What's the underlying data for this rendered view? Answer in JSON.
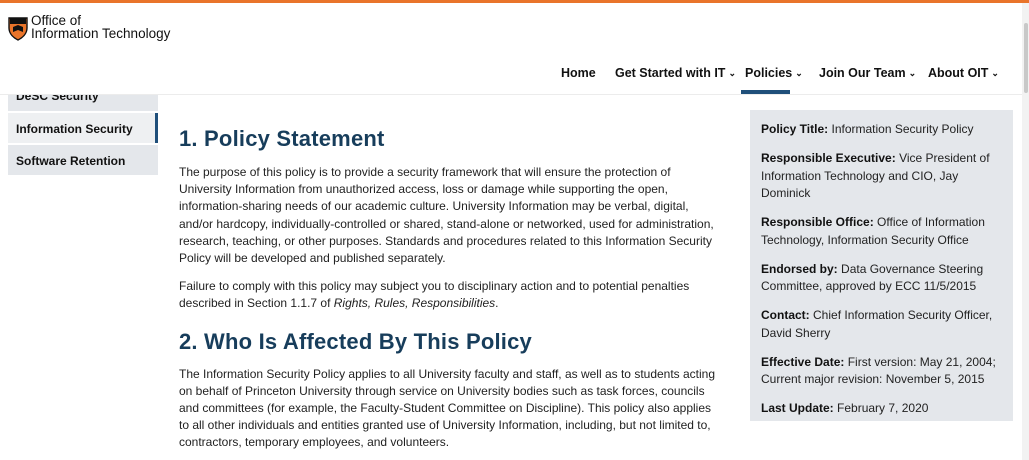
{
  "header": {
    "logo_line1": "Office of",
    "logo_line2": "Information Technology"
  },
  "nav": {
    "items": [
      {
        "label": "Home",
        "has_chevron": false
      },
      {
        "label": "Get Started with IT",
        "has_chevron": true
      },
      {
        "label": "Policies",
        "has_chevron": true,
        "active": true
      },
      {
        "label": "Join Our Team",
        "has_chevron": true
      },
      {
        "label": "About OIT",
        "has_chevron": true
      }
    ],
    "chevron": "⌄"
  },
  "sidebar": {
    "items": [
      {
        "label": "DeSC Security"
      },
      {
        "label": "Information Security",
        "active": true
      },
      {
        "label": "Software Retention"
      }
    ]
  },
  "main": {
    "section1_title": "1.  Policy Statement",
    "section1_p1": "The purpose of this policy is to provide a security framework that will ensure the protection of University Information from unauthorized access, loss or damage while supporting the open, information-sharing needs of our academic culture.  University Information may be verbal, digital, and/or hardcopy, individually-controlled or shared, stand-alone or networked, used for administration, research, teaching, or other purposes.  Standards and procedures related to this Information Security Policy will be developed and published separately.",
    "section1_p2_prefix": "Failure to comply with this policy may subject you to disciplinary action and to potential penalties described in Section 1.1.7 of ",
    "section1_p2_italic": "Rights, Rules, Responsibilities",
    "section1_p2_suffix": ".",
    "section2_title": "2.  Who Is Affected By This Policy",
    "section2_p1": "The Information Security Policy applies to all University faculty and staff, as well as to students acting on behalf of Princeton University through service on University bodies such as task forces, councils and committees (for example, the Faculty-Student Committee on Discipline).  This policy also applies to all other individuals and entities granted use of University Information, including, but not limited to, contractors, temporary employees, and volunteers."
  },
  "infobox": {
    "rows": [
      {
        "label": "Policy Title:",
        "value": "Information Security Policy"
      },
      {
        "label": "Responsible Executive:",
        "value": "Vice President of Information Technology and CIO, Jay Dominick"
      },
      {
        "label": "Responsible Office:",
        "value": "Office of Information Technology, Information Security Office"
      },
      {
        "label": "Endorsed by:",
        "value": "Data Governance Steering Committee, approved by ECC 11/5/2015"
      },
      {
        "label": "Contact:",
        "value": "Chief Information Security Officer, David Sherry"
      },
      {
        "label": "Effective Date:",
        "value": "First version: May 21, 2004; Current major revision: November 5, 2015"
      },
      {
        "label": "Last Update:",
        "value": "February 7, 2020"
      }
    ]
  },
  "colors": {
    "accent_orange": "#e9742a",
    "heading_blue": "#173d5b",
    "nav_active": "#1f4f7a",
    "panel_gray": "#e4e7eb"
  }
}
